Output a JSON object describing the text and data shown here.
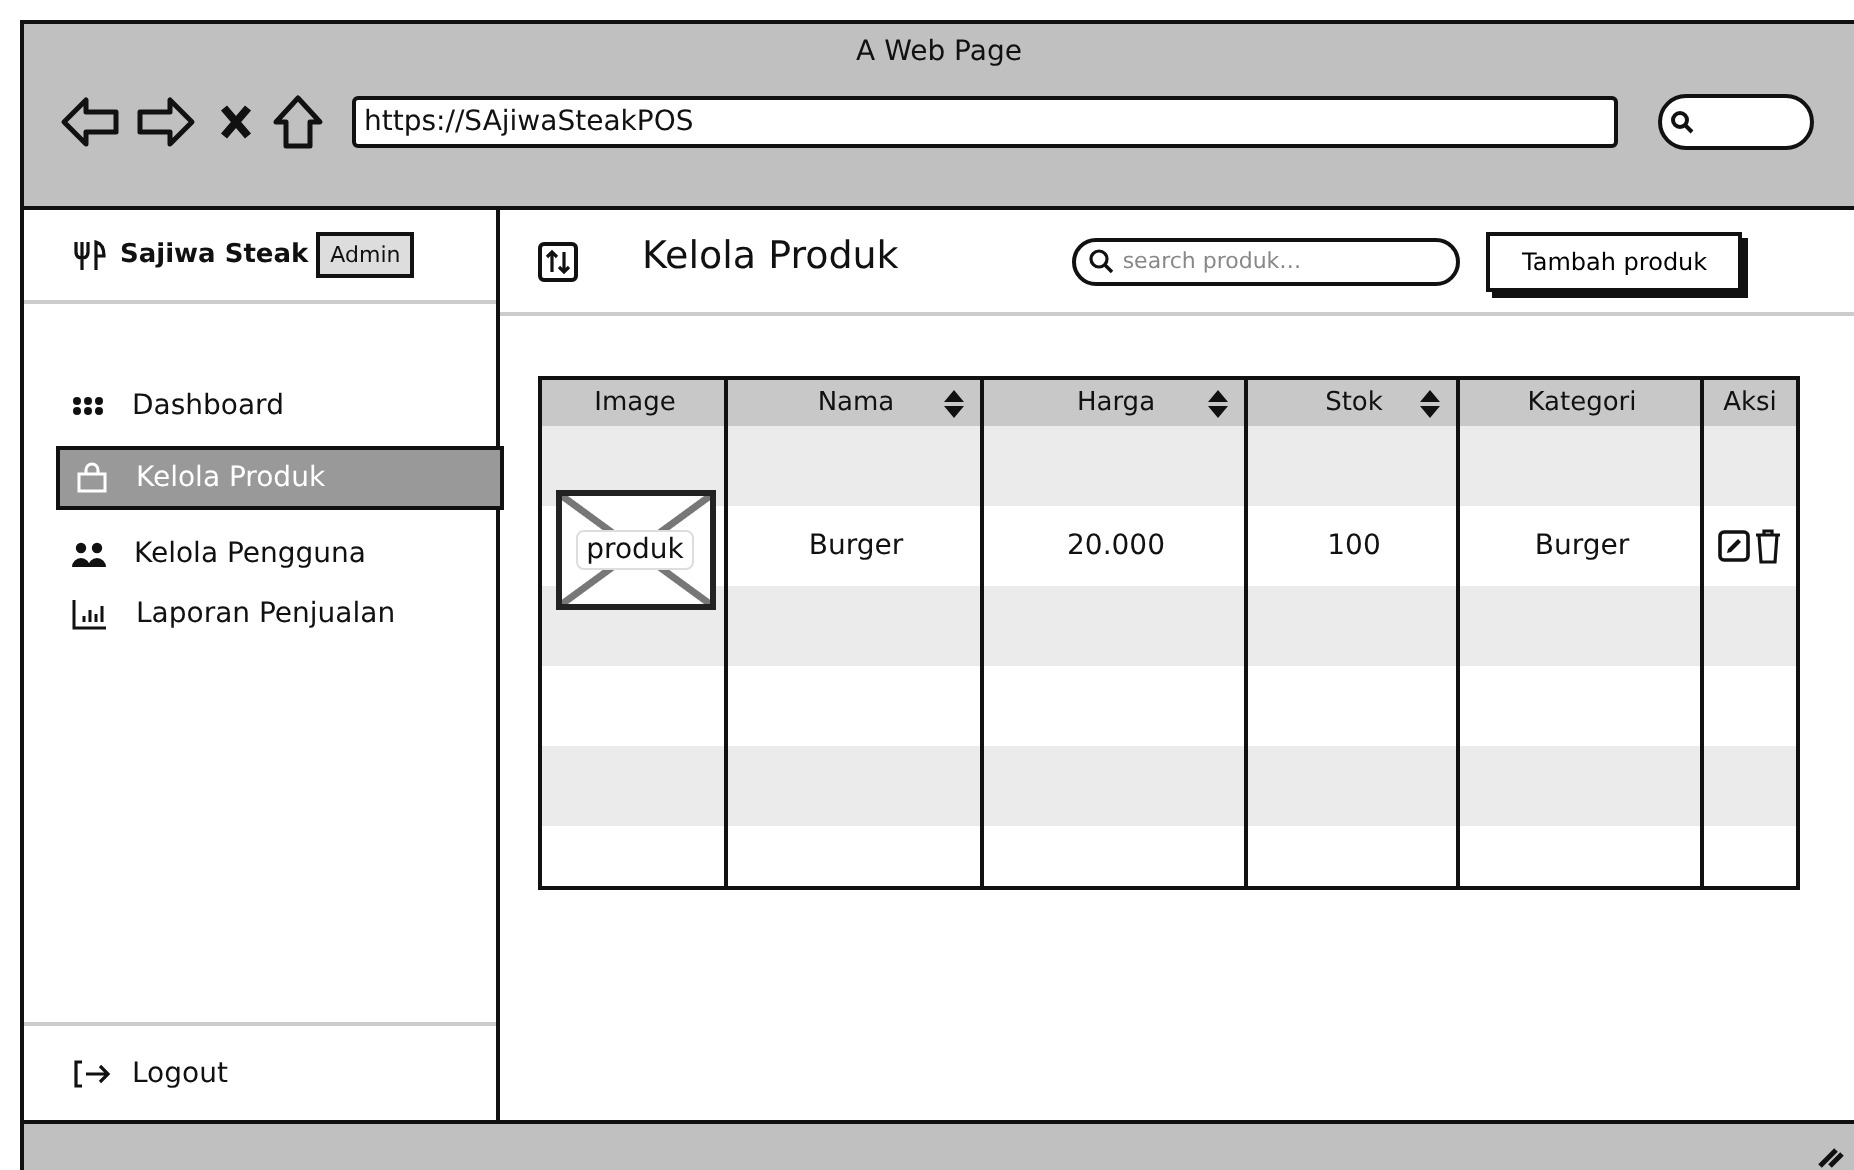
{
  "window": {
    "title": "A Web Page",
    "url": "https://SAjiwaSteakPOS"
  },
  "sidebar": {
    "brand": "Sajiwa Steak",
    "role_badge": "Admin",
    "items": [
      {
        "label": "Dashboard",
        "selected": false
      },
      {
        "label": "Kelola Produk",
        "selected": true
      },
      {
        "label": "Kelola Pengguna",
        "selected": false
      },
      {
        "label": "Laporan Penjualan",
        "selected": false
      }
    ],
    "logout": "Logout"
  },
  "header": {
    "title": "Kelola Produk",
    "search": {
      "placeholder": "search produk…"
    },
    "add_button": "Tambah produk"
  },
  "table": {
    "columns": [
      {
        "label": "Image",
        "sortable": false
      },
      {
        "label": "Nama",
        "sortable": true
      },
      {
        "label": "Harga",
        "sortable": true
      },
      {
        "label": "Stok",
        "sortable": true
      },
      {
        "label": "Kategori",
        "sortable": false
      },
      {
        "label": "Aksi",
        "sortable": false
      }
    ],
    "rows": [
      {
        "image_label": "produk",
        "nama": "Burger",
        "harga": "20.000",
        "stok": "100",
        "kategori": "Burger"
      }
    ]
  }
}
